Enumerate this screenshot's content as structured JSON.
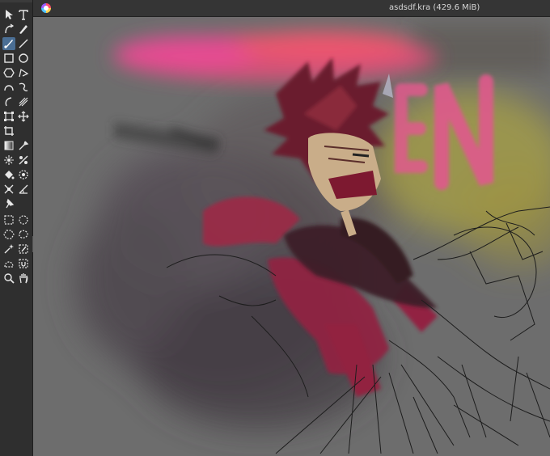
{
  "window": {
    "title": "asdsdf.kra (429.6 MiB)"
  },
  "toolbox": {
    "tools": [
      {
        "name": "select-shapes-tool-icon"
      },
      {
        "name": "text-tool-icon"
      },
      {
        "name": "edit-shapes-tool-icon"
      },
      {
        "name": "calligraphy-tool-icon"
      },
      {
        "name": "freehand-brush-tool-icon"
      },
      {
        "name": "line-tool-icon"
      },
      {
        "name": "rectangle-tool-icon"
      },
      {
        "name": "ellipse-tool-icon"
      },
      {
        "name": "polygon-tool-icon"
      },
      {
        "name": "polyline-tool-icon"
      },
      {
        "name": "bezier-curve-tool-icon"
      },
      {
        "name": "freehand-path-tool-icon"
      },
      {
        "name": "dynamic-brush-tool-icon"
      },
      {
        "name": "multibrush-tool-icon"
      },
      {
        "name": "transform-tool-icon"
      },
      {
        "name": "move-tool-icon"
      },
      {
        "name": "crop-tool-icon"
      },
      {
        "name": "gradient-tool-icon"
      },
      {
        "name": "color-picker-icon"
      },
      {
        "name": "colorize-mask-tool-icon"
      },
      {
        "name": "smart-patch-tool-icon"
      },
      {
        "name": "fill-tool-icon"
      },
      {
        "name": "enclose-fill-tool-icon"
      },
      {
        "name": "assistant-tool-icon"
      },
      {
        "name": "measure-tool-icon"
      },
      {
        "name": "reference-images-tool-icon"
      },
      {
        "name": "rectangular-selection-icon"
      },
      {
        "name": "elliptical-selection-icon"
      },
      {
        "name": "polygonal-selection-icon"
      },
      {
        "name": "freehand-selection-icon"
      },
      {
        "name": "contiguous-selection-icon"
      },
      {
        "name": "similar-color-selection-icon"
      },
      {
        "name": "bezier-selection-icon"
      },
      {
        "name": "magnetic-selection-icon"
      },
      {
        "name": "zoom-tool-icon"
      },
      {
        "name": "pan-tool-icon"
      }
    ],
    "active_tool": "freehand-brush-tool-icon",
    "accent_color": "#4a6e94"
  },
  "canvas": {
    "background_color": "#6d6d6d",
    "painted_text": "EN"
  }
}
